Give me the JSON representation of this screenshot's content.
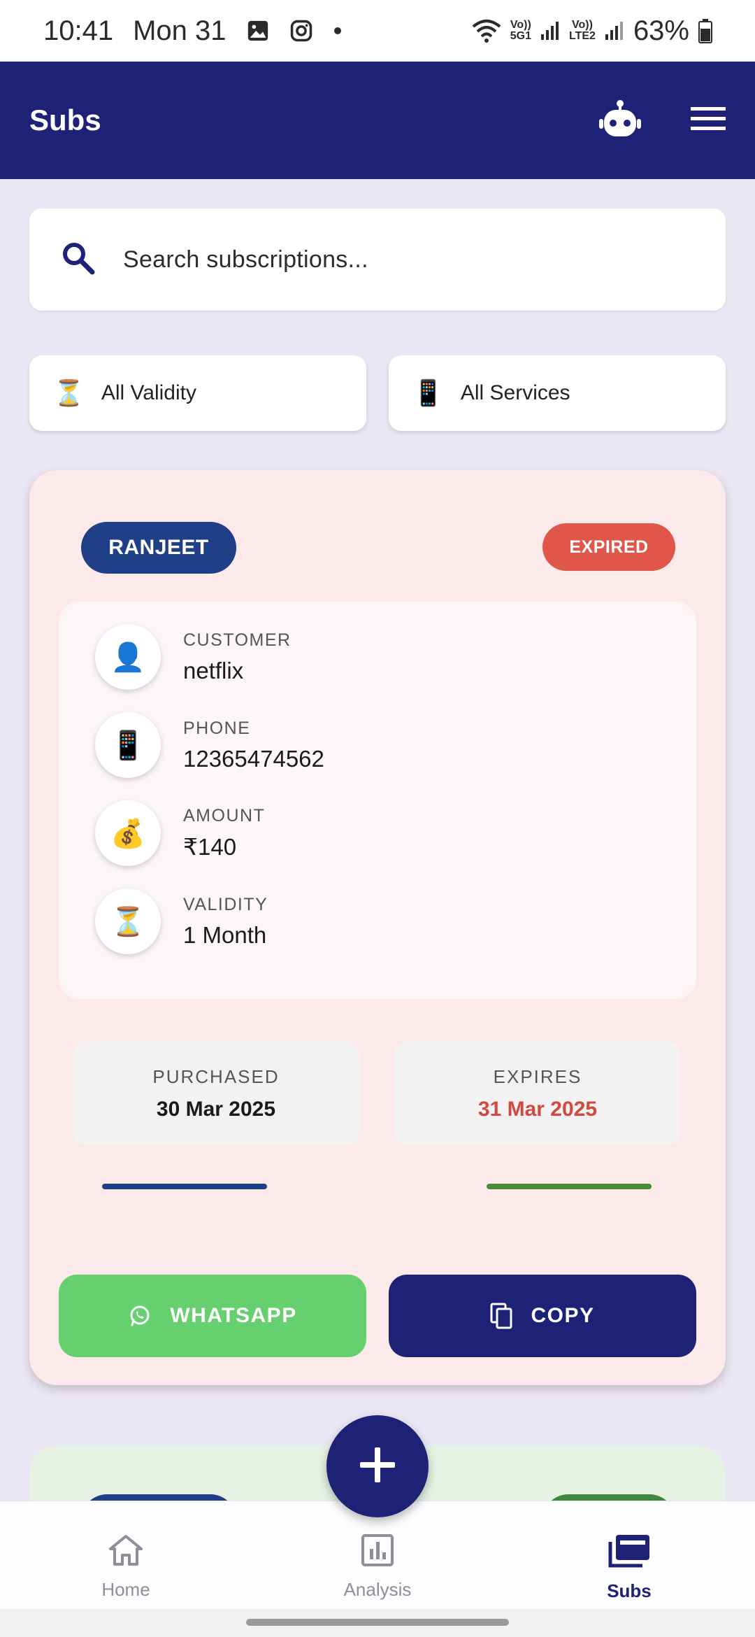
{
  "status_bar": {
    "time": "10:41",
    "date": "Mon 31",
    "net1_top": "Vo))",
    "net1_bottom": "5G1",
    "net2_top": "Vo))",
    "net2_bottom": "LTE2",
    "battery": "63%"
  },
  "app_bar": {
    "title": "Subs",
    "icons": [
      "robot-icon",
      "menu-icon"
    ]
  },
  "search": {
    "placeholder": "Search subscriptions..."
  },
  "filters": {
    "validity": {
      "emoji": "⏳",
      "label": "All Validity"
    },
    "services": {
      "emoji": "📱",
      "label": "All Services"
    }
  },
  "card": {
    "name": "RANJEET",
    "status": "EXPIRED",
    "fields": [
      {
        "emoji": "👤",
        "label": "CUSTOMER",
        "value": "netflix"
      },
      {
        "emoji": "📱",
        "label": "PHONE",
        "value": "12365474562"
      },
      {
        "emoji": "💰",
        "label": "AMOUNT",
        "value": "₹140"
      },
      {
        "emoji": "⏳",
        "label": "VALIDITY",
        "value": "1 Month"
      }
    ],
    "purchased": {
      "label": "PURCHASED",
      "value": "30 Mar 2025"
    },
    "expires": {
      "label": "EXPIRES",
      "value": "31 Mar 2025"
    },
    "buttons": {
      "whatsapp": "WHATSAPP",
      "copy": "COPY"
    }
  },
  "nav": {
    "home": "Home",
    "analysis": "Analysis",
    "subs": "Subs"
  },
  "colors": {
    "primary": "#1e2277",
    "name_badge": "#1f3f86",
    "expired": "#e05648",
    "whatsapp": "#66d06f",
    "expires_date": "#d0483e",
    "bar_blue": "#1f3f86",
    "bar_green": "#4a8a3a"
  }
}
